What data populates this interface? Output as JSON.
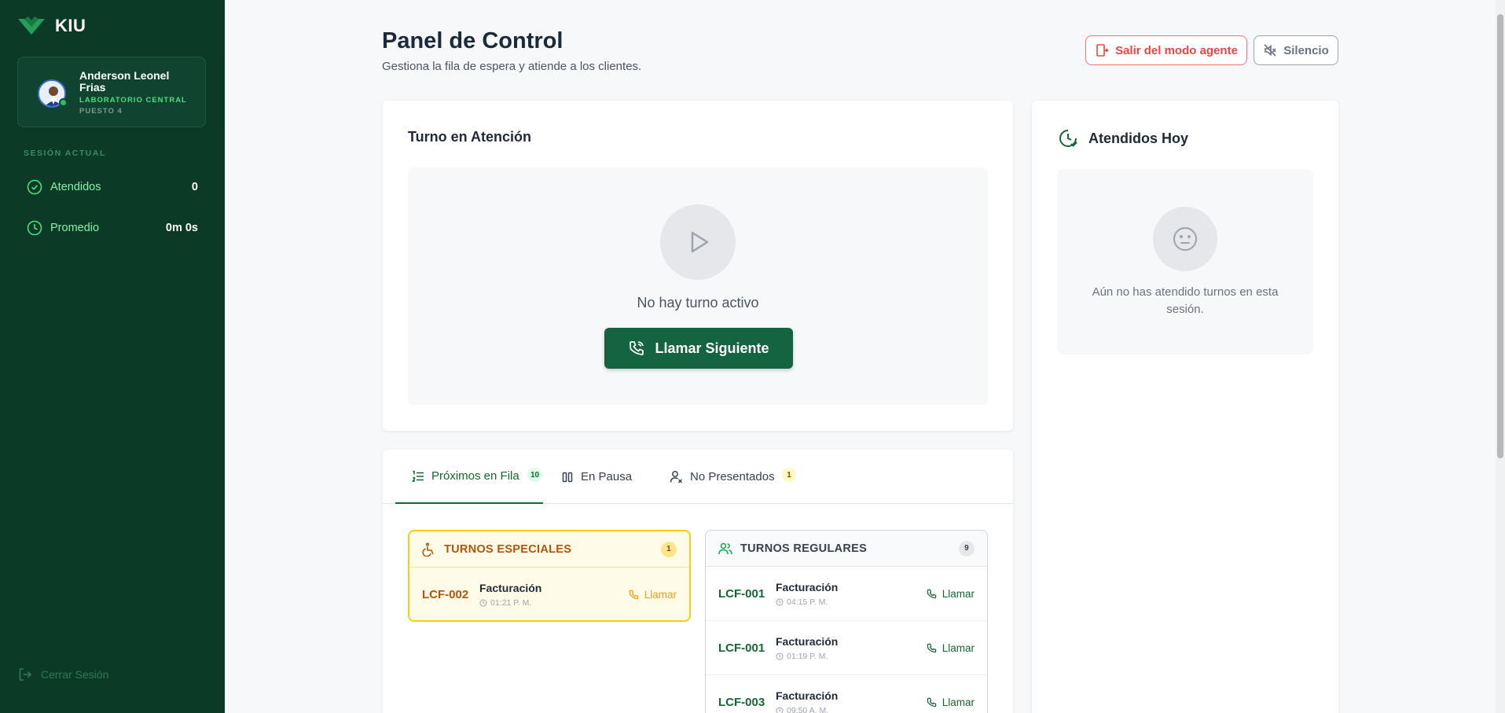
{
  "brand": {
    "name": "KIU"
  },
  "profile": {
    "name": "Anderson Leonel Frias",
    "location": "LABORATORIO CENTRAL",
    "station": "PUESTO 4"
  },
  "session": {
    "title": "SESIÓN ACTUAL",
    "stats": [
      {
        "label": "Atendidos",
        "value": "0"
      },
      {
        "label": "Promedio",
        "value": "0m 0s"
      }
    ]
  },
  "logout_label": "Cerrar Sesión",
  "header": {
    "title": "Panel de Control",
    "subtitle": "Gestiona la fila de espera y atiende a los clientes.",
    "exit_agent_label": "Salir del modo agente",
    "mute_label": "Silencio"
  },
  "current": {
    "title": "Turno en Atención",
    "empty_text": "No hay turno activo",
    "call_next_label": "Llamar Siguiente"
  },
  "attended": {
    "title": "Atendidos Hoy",
    "empty_text": "Aún no has atendido turnos en esta sesión."
  },
  "tabs": [
    {
      "label": "Próximos en Fila",
      "badge": "10"
    },
    {
      "label": "En Pausa",
      "badge": ""
    },
    {
      "label": "No Presentados",
      "badge": "1"
    }
  ],
  "special": {
    "title": "TURNOS ESPECIALES",
    "count": "1",
    "items": [
      {
        "code": "LCF-002",
        "service": "Facturación",
        "time": "01:21 P. M.",
        "action": "Llamar"
      }
    ]
  },
  "regular": {
    "title": "TURNOS REGULARES",
    "count": "9",
    "items": [
      {
        "code": "LCF-001",
        "service": "Facturación",
        "time": "04:15 P. M.",
        "action": "Llamar"
      },
      {
        "code": "LCF-001",
        "service": "Facturación",
        "time": "01:19 P. M.",
        "action": "Llamar"
      },
      {
        "code": "LCF-003",
        "service": "Facturación",
        "time": "09:50 A. M.",
        "action": "Llamar"
      }
    ]
  },
  "colors": {
    "sidebar": "#0b3b26",
    "primary": "#13643f",
    "accent_green": "#4ade80",
    "danger": "#ef4444",
    "special": "#b45309"
  }
}
